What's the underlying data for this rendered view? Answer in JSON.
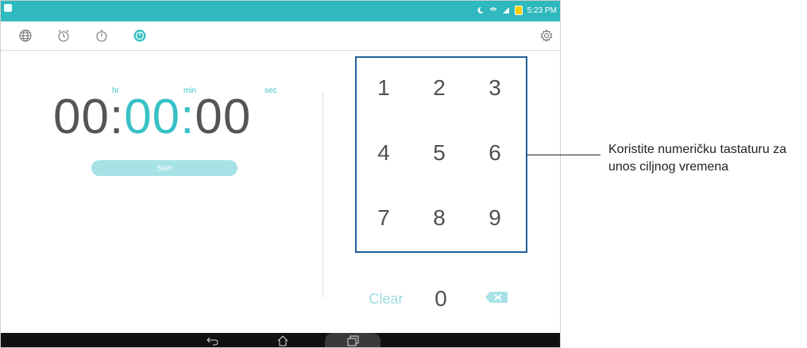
{
  "status_bar": {
    "time": "5:23 PM",
    "color": "#2fb8bd"
  },
  "toolbar": {
    "tabs": [
      {
        "icon": "globe-icon",
        "active": false
      },
      {
        "icon": "alarm-clock-icon",
        "active": false
      },
      {
        "icon": "stopwatch-icon",
        "active": false
      },
      {
        "icon": "timer-icon",
        "active": true
      }
    ],
    "settings_icon": "gear-icon"
  },
  "timer": {
    "units": {
      "hr": "hr",
      "min": "min",
      "sec": "sec"
    },
    "hours": "00",
    "minutes": "00",
    "seconds": "00",
    "separator": ":",
    "start_label": "Start",
    "accent_color": "#38c1c6"
  },
  "keypad": {
    "keys": [
      "1",
      "2",
      "3",
      "4",
      "5",
      "6",
      "7",
      "8",
      "9"
    ],
    "clear_label": "Clear",
    "zero": "0",
    "backspace_icon": "backspace-icon"
  },
  "nav_bar": {
    "back_icon": "back-icon",
    "home_icon": "home-icon",
    "recent_icon": "recent-apps-icon"
  },
  "callout": {
    "text": "Koristite numeričku tastaturu za unos ciljnog vremena"
  }
}
